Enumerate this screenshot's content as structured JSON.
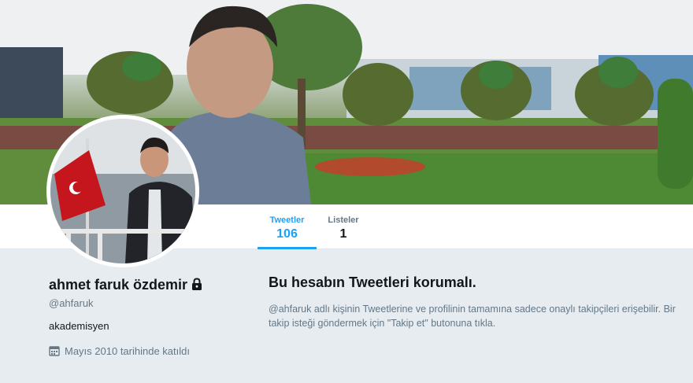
{
  "nav": {
    "tabs": [
      {
        "label": "Tweetler",
        "count": "106",
        "active": true
      },
      {
        "label": "Listeler",
        "count": "1",
        "active": false
      }
    ]
  },
  "profile": {
    "name": "ahmet faruk özdemir",
    "handle": "@ahfaruk",
    "bio": "akademisyen",
    "joined": "Mayıs 2010 tarihinde katıldı",
    "protected": true
  },
  "protected_notice": {
    "title": "Bu hesabın Tweetleri korumalı.",
    "text": "@ahfaruk adlı kişinin Tweetlerine ve profilinin tamamına sadece onaylı takipçileri erişebilir. Bir takip isteği göndermek için \"Takip et\" butonuna tıkla."
  },
  "icons": {
    "lock": "lock-icon",
    "calendar": "calendar-icon"
  },
  "colors": {
    "accent": "#1da1f2",
    "background": "#e6ecf0",
    "muted_text": "#657786"
  }
}
